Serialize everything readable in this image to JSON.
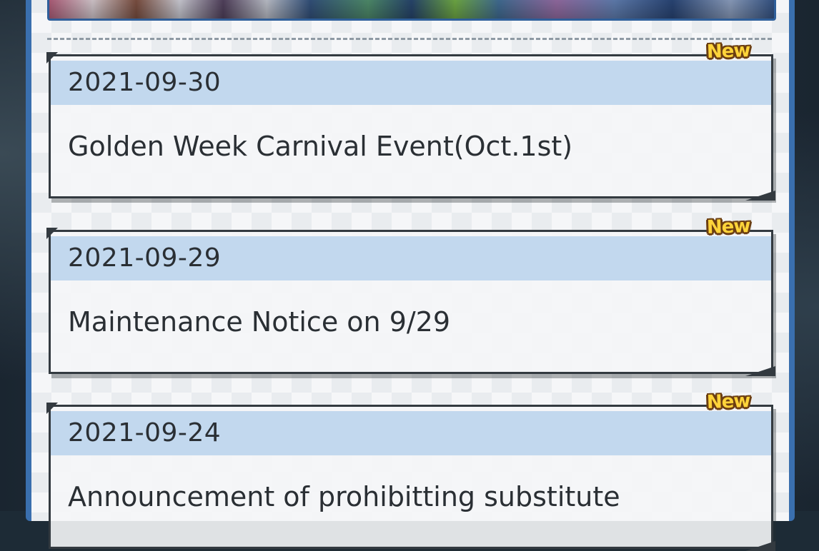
{
  "notices": [
    {
      "date": "2021-09-30",
      "title": "Golden Week Carnival Event(Oct.1st)",
      "badge": "New"
    },
    {
      "date": "2021-09-29",
      "title": "Maintenance Notice on 9/29",
      "badge": "New"
    },
    {
      "date": "2021-09-24",
      "title": "Announcement of prohibitting substitute",
      "badge": "New"
    }
  ],
  "colors": {
    "panel_frame": "#3a6fae",
    "date_bar": "#c2d8ee",
    "badge_fill": "#ffd43a",
    "badge_outline": "#6b3e12"
  }
}
